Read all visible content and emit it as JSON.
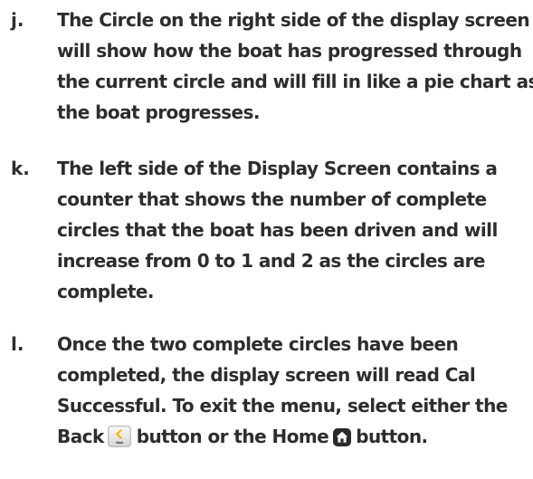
{
  "items": [
    {
      "marker": "j.",
      "lines": [
        "The Circle on the right side of the display screen",
        "will show how the boat has progressed through",
        "the current circle and will fill in like a pie chart as",
        "the boat progresses."
      ]
    },
    {
      "marker": "k.",
      "lines": [
        "The left side of the Display Screen contains a",
        "counter that shows the number of complete",
        "circles that the boat has been driven and will",
        "increase from 0 to 1 and 2 as the circles are",
        "complete."
      ]
    },
    {
      "marker": "l.",
      "lines": [
        "Once the two complete circles have been",
        "completed, the display screen will read Cal",
        "Successful. To exit the menu, select either the"
      ],
      "last_line": {
        "before_back": "Back",
        "between": "button or the Home",
        "after_home": "button."
      },
      "back_icon_label": "Back"
    }
  ],
  "icons": {
    "back": "back-button-icon",
    "home": "home-button-icon",
    "accent": "#f2b705"
  }
}
